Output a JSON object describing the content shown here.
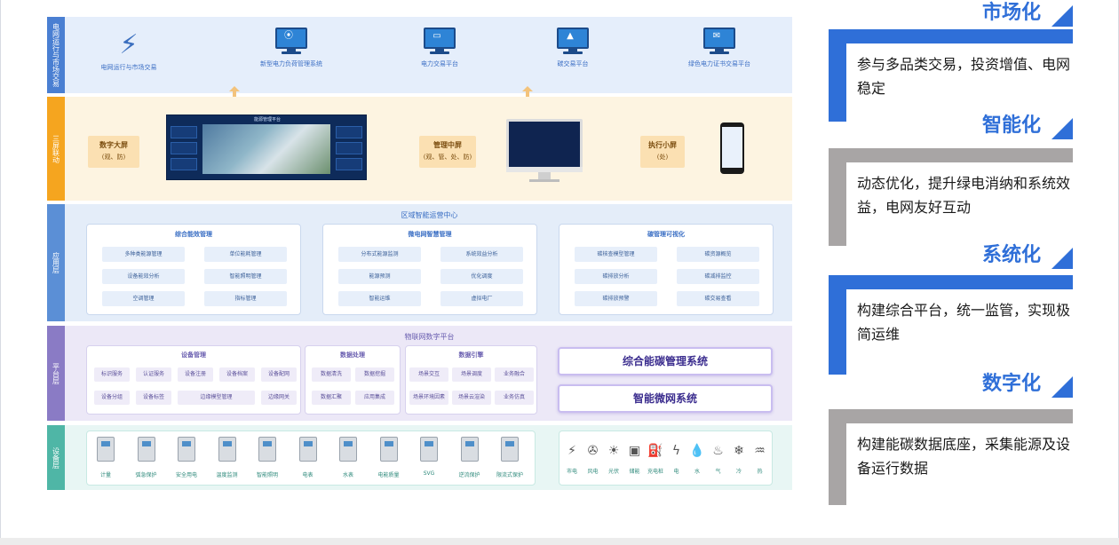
{
  "layers": {
    "grid": {
      "side": "电网运行与市场交易",
      "systems": [
        "电网运行与市场交易",
        "新型电力负荷管理系统",
        "电力交易平台",
        "碳交易平台",
        "绿色电力证书交易平台"
      ]
    },
    "screens": {
      "side": "三屏联动",
      "big": {
        "title": "数字大屏",
        "sub": "(观、防)",
        "display_title": "能源管理平台"
      },
      "mid": {
        "title": "管理中屏",
        "sub": "(观、管、处、防)"
      },
      "small": {
        "title": "执行小屏",
        "sub": "(处)"
      }
    },
    "app": {
      "side": "应用层",
      "title": "区域智能运营中心",
      "cards": [
        {
          "title": "综合能效管理",
          "items": [
            "多种类能源管理",
            "单位能耗管理",
            "设备能效分析",
            "智能照明管理",
            "空调管理",
            "指标管理"
          ]
        },
        {
          "title": "微电网智慧管理",
          "items": [
            "分布式能源监测",
            "系统效益分析",
            "能源预测",
            "优化调度",
            "智能运维",
            "虚拟电厂"
          ]
        },
        {
          "title": "碳管理可视化",
          "items": [
            "碳核查模型管理",
            "碳资源概览",
            "碳排放分析",
            "碳减排监控",
            "碳排放预警",
            "碳交易查看"
          ]
        }
      ]
    },
    "platform": {
      "side": "平台层",
      "title": "物联网数字平台",
      "device_mgmt": {
        "title": "设备管理",
        "items": [
          "标识服务",
          "认证服务",
          "设备注册",
          "设备档案",
          "设备配网",
          "设备分组",
          "设备标签",
          "边缘模型管理",
          "边缘网关"
        ]
      },
      "data_proc": {
        "title": "数据处理",
        "items": [
          "数据清洗",
          "数据挖掘",
          "数据汇聚",
          "应用集成"
        ]
      },
      "data_engine": {
        "title": "数据引擎",
        "items": [
          "场景交互",
          "场景调度",
          "业务融合",
          "场景环境因素",
          "场景云渲染",
          "业务仿真"
        ]
      },
      "systems": [
        "综合能碳管理系统",
        "智能微网系统"
      ]
    },
    "device": {
      "side": "设备层",
      "devices": [
        "计量",
        "弧急保护",
        "安全用电",
        "温度监测",
        "智能照明",
        "电表",
        "水表",
        "电能质量",
        "SVG",
        "逆流保护",
        "限流式保护"
      ],
      "energy": [
        {
          "label": "市电",
          "icon": "utility-pole-icon",
          "glyph": "⚡"
        },
        {
          "label": "风电",
          "icon": "wind-turbine-icon",
          "glyph": "✇"
        },
        {
          "label": "光伏",
          "icon": "solar-panel-icon",
          "glyph": "☀"
        },
        {
          "label": "储能",
          "icon": "battery-icon",
          "glyph": "▣"
        },
        {
          "label": "充电桩",
          "icon": "charger-icon",
          "glyph": "⛽"
        },
        {
          "label": "电",
          "icon": "electricity-icon",
          "glyph": "ϟ"
        },
        {
          "label": "水",
          "icon": "water-drop-icon",
          "glyph": "💧"
        },
        {
          "label": "气",
          "icon": "gas-flame-icon",
          "glyph": "♨"
        },
        {
          "label": "冷",
          "icon": "snowflake-icon",
          "glyph": "❄"
        },
        {
          "label": "热",
          "icon": "heat-icon",
          "glyph": "♒"
        }
      ]
    }
  },
  "right": [
    {
      "title": "市场化",
      "text": "参与多品类交易，投资增值、电网稳定",
      "color": "#2f6fd8"
    },
    {
      "title": "智能化",
      "text": "动态优化，提升绿电消纳和系统效益，电网友好互动",
      "color": "#a8a5a5"
    },
    {
      "title": "系统化",
      "text": "构建综合平台，统一监管，实现极简运维",
      "color": "#2f6fd8"
    },
    {
      "title": "数字化",
      "text": "构建能碳数据底座，采集能源及设备运行数据",
      "color": "#a8a5a5"
    }
  ]
}
